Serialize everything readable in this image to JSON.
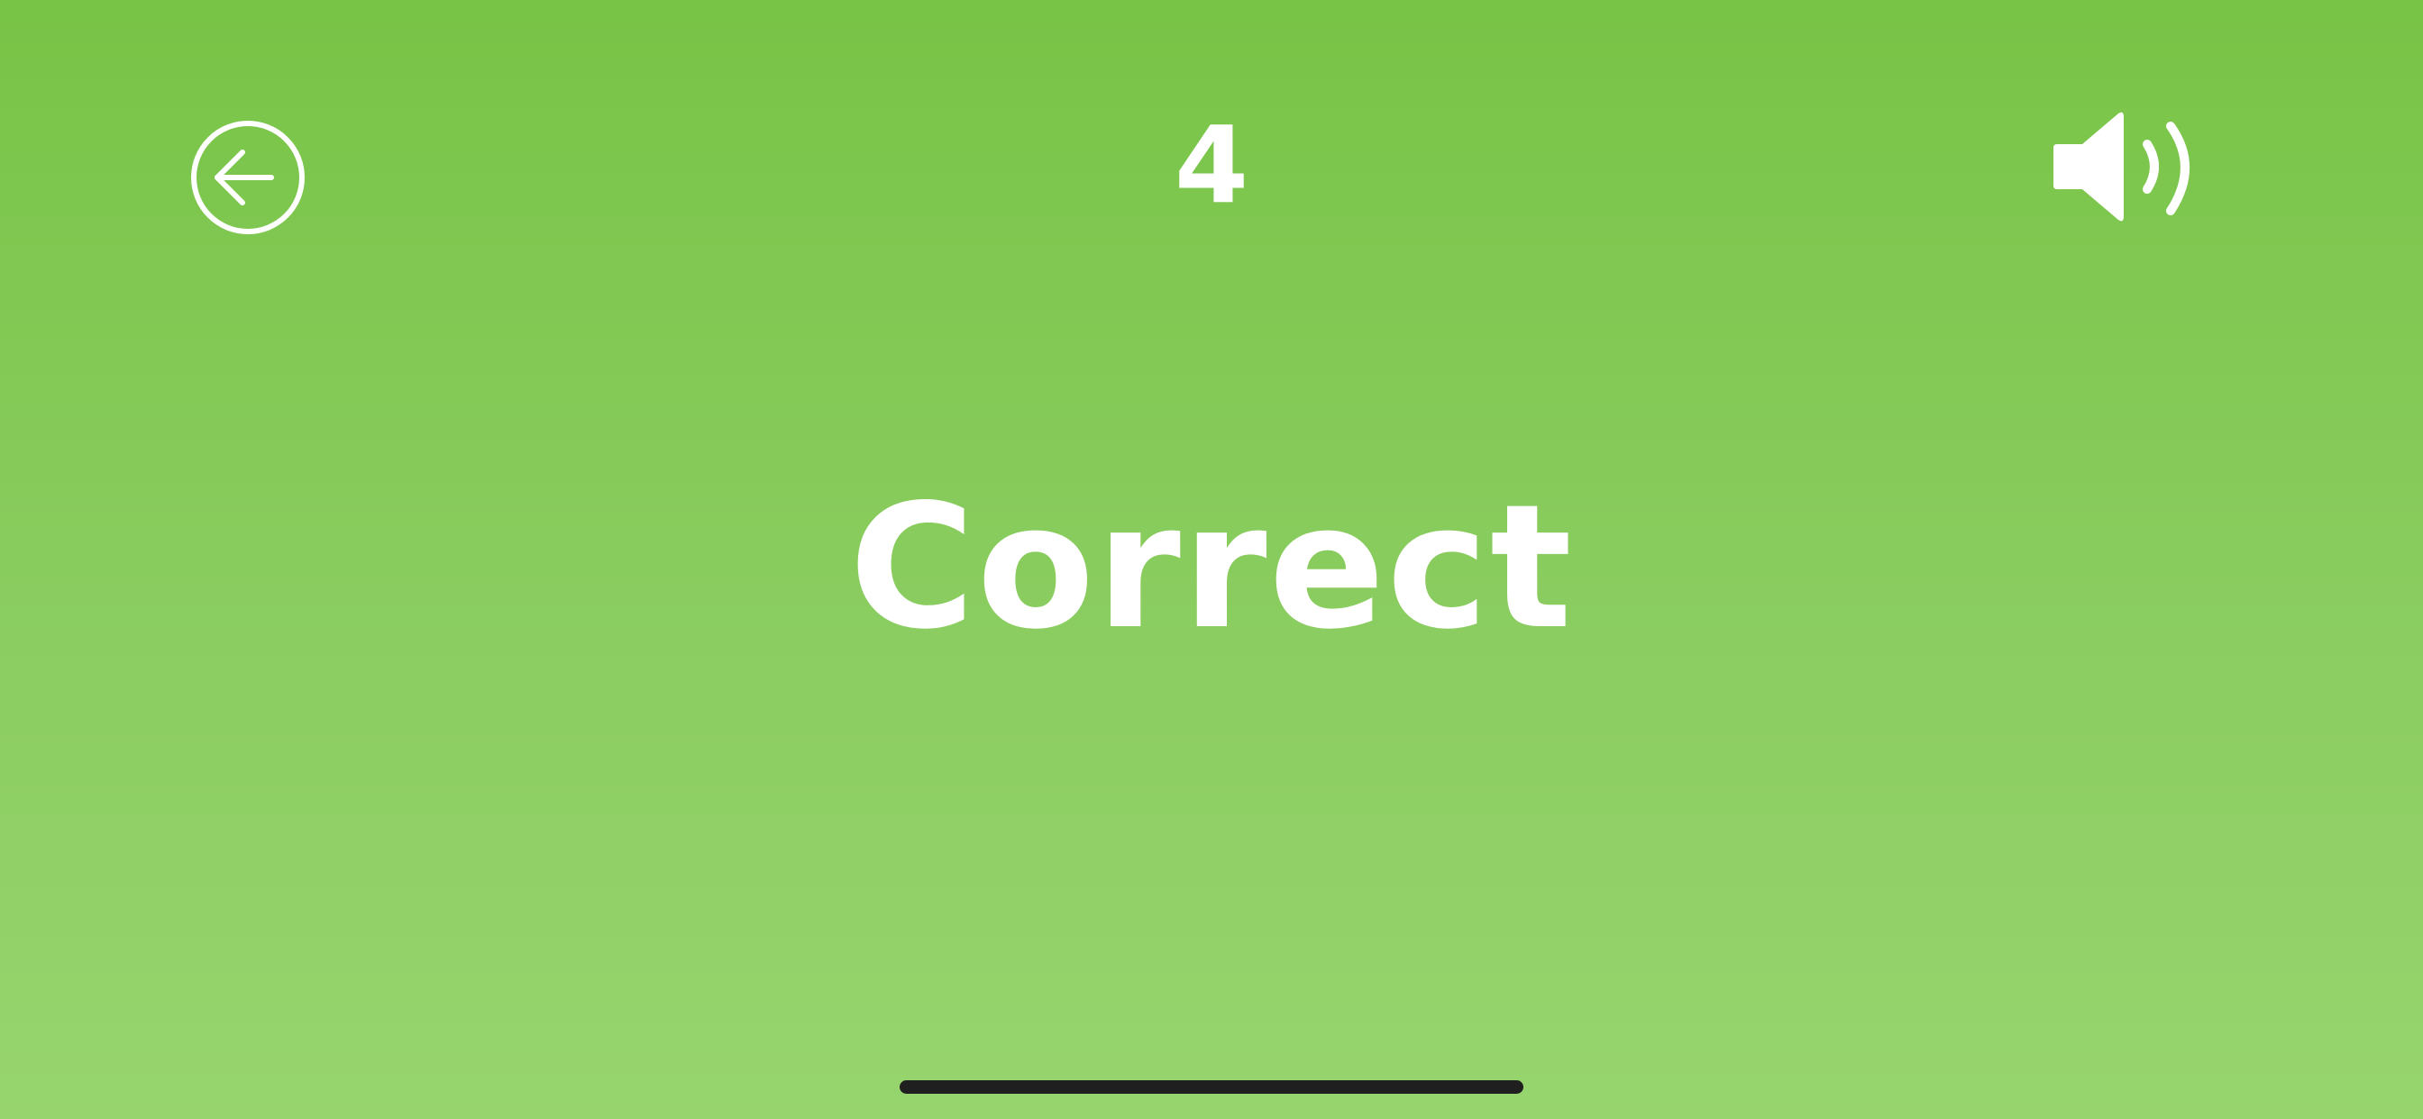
{
  "header": {
    "back_icon": "back-arrow-circle-icon",
    "score": "4",
    "sound_icon": "speaker-volume-icon"
  },
  "main": {
    "result_label": "Correct"
  },
  "colors": {
    "background_top": "#78c446",
    "background_bottom": "#97d46e",
    "foreground": "#ffffff",
    "home_indicator": "#1f1f1f"
  }
}
